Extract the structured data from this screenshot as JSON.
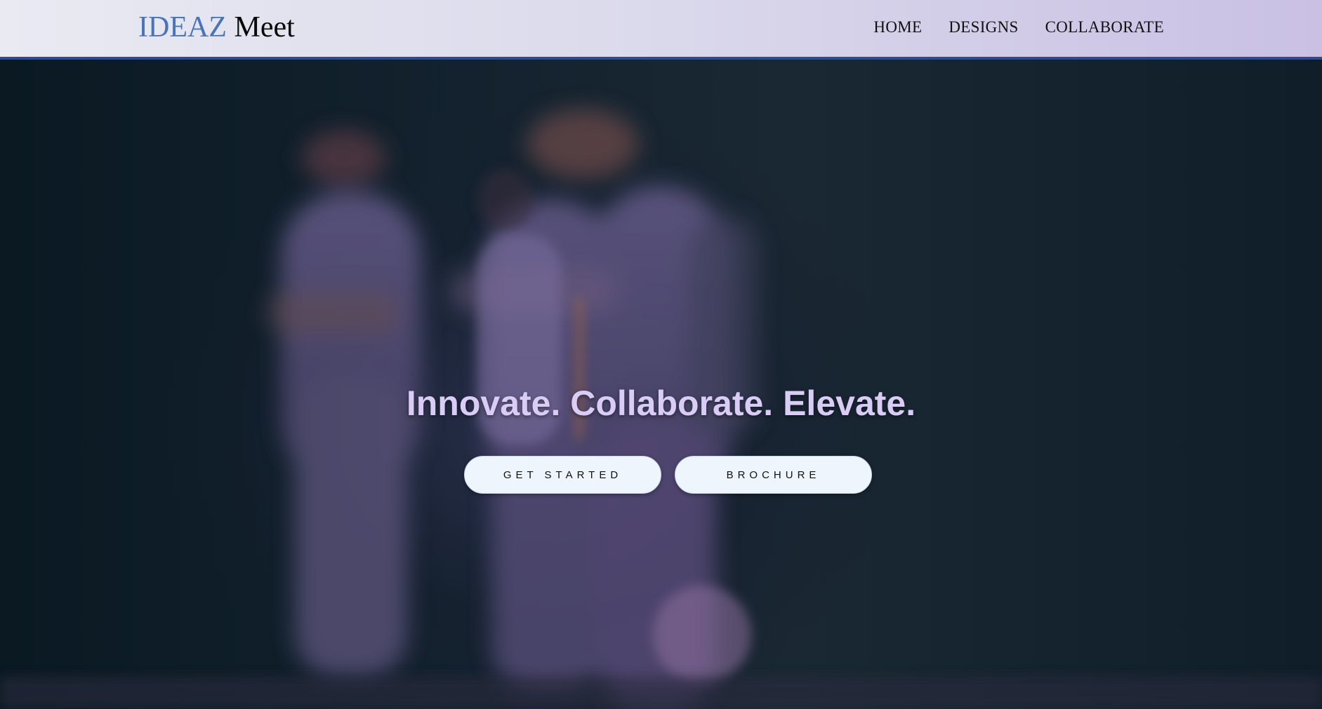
{
  "header": {
    "brand": {
      "accent": "IDEAZ",
      "main": "Meet"
    },
    "nav": [
      {
        "label": "HOME"
      },
      {
        "label": "DESIGNS"
      },
      {
        "label": "COLLABORATE"
      }
    ]
  },
  "hero": {
    "background_image": "blurred-dancers-photo",
    "headline": "Innovate. Collaborate. Elevate.",
    "buttons": {
      "get_started": "GET STARTED",
      "brochure": "BROCHURE"
    }
  },
  "colors": {
    "brand_accent": "#4a74b8",
    "header_border": "#2e4a91",
    "headline": "#d9cdf6",
    "button_bg": "#eef5fd"
  }
}
